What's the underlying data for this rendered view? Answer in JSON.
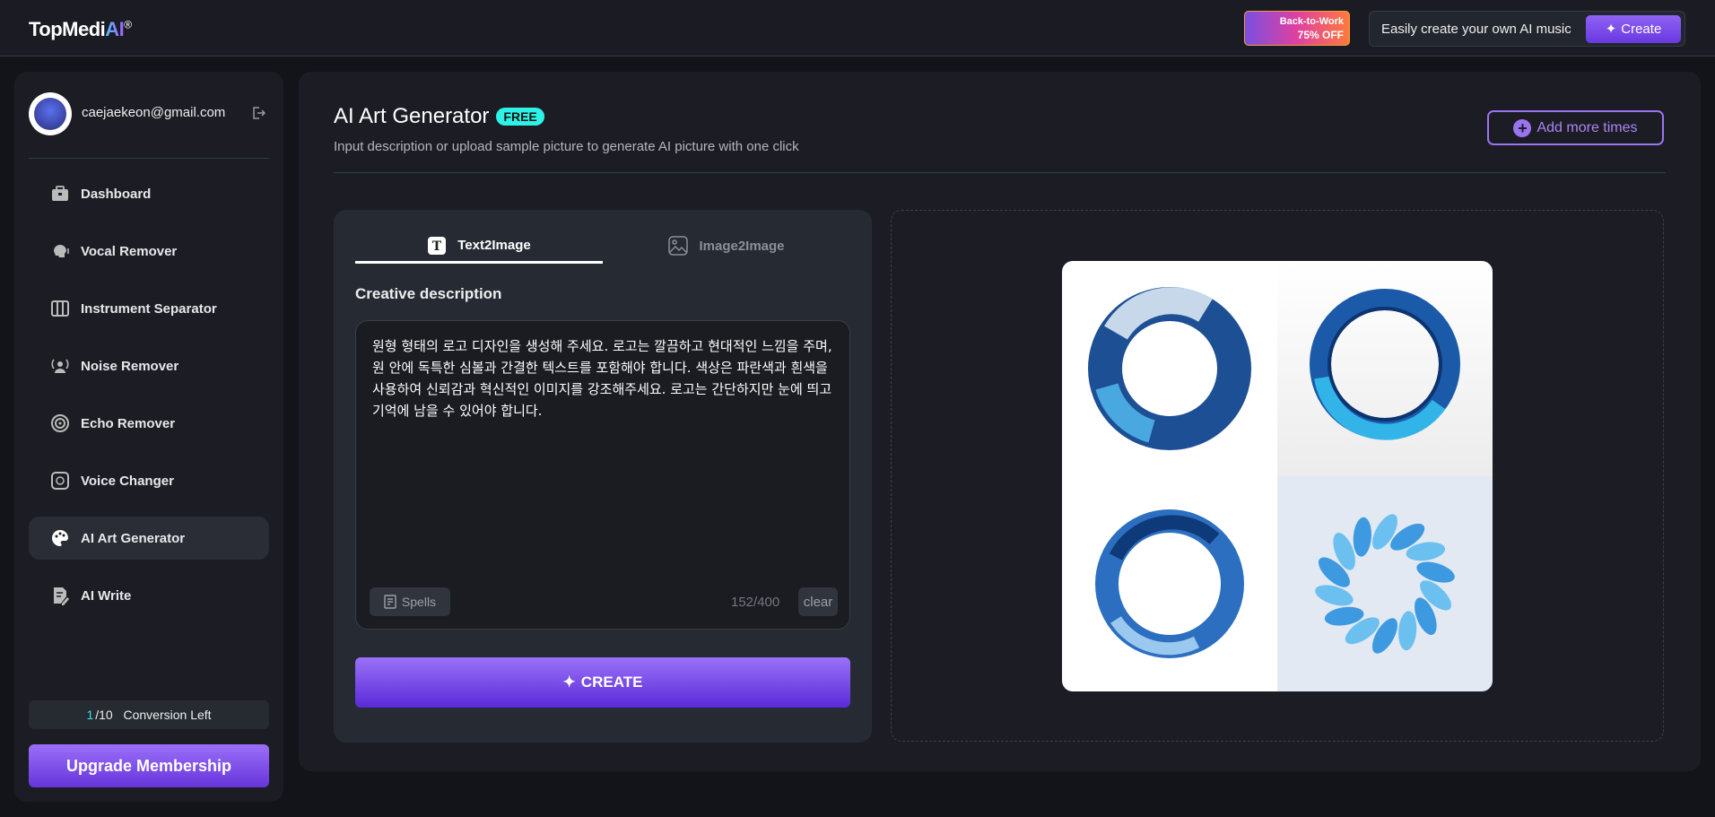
{
  "header": {
    "logo": {
      "text": "TopMedi",
      "ai": "AI",
      "reg": "®"
    },
    "promo": {
      "line1": "Back-to-Work",
      "line2": "75% OFF"
    },
    "cta_text": "Easily create your own AI music",
    "cta_button": "Create"
  },
  "sidebar": {
    "email": "caejaekeon@gmail.com",
    "items": [
      {
        "label": "Dashboard",
        "icon": "briefcase-icon"
      },
      {
        "label": "Vocal Remover",
        "icon": "head-voice-icon"
      },
      {
        "label": "Instrument Separator",
        "icon": "piano-icon"
      },
      {
        "label": "Noise Remover",
        "icon": "broadcast-user-icon"
      },
      {
        "label": "Echo Remover",
        "icon": "echo-icon"
      },
      {
        "label": "Voice Changer",
        "icon": "voice-changer-icon"
      },
      {
        "label": "AI Art Generator",
        "icon": "palette-icon",
        "active": true
      },
      {
        "label": "AI Write",
        "icon": "write-icon"
      }
    ],
    "conversion": {
      "used": "1",
      "total": "/10",
      "label": "Conversion Left"
    },
    "upgrade": "Upgrade Membership"
  },
  "main": {
    "title": "AI Art Generator",
    "badge": "FREE",
    "subtitle": "Input description or upload sample picture to generate AI picture with one click",
    "add_more": "Add more times",
    "tabs": [
      {
        "label": "Text2Image",
        "active": true
      },
      {
        "label": "Image2Image"
      }
    ],
    "description_label": "Creative description",
    "prompt": "원형 형태의 로고 디자인을 생성해 주세요. 로고는 깔끔하고 현대적인 느낌을 주며, 원 안에 독특한 심볼과 간결한 텍스트를 포함해야 합니다. 색상은 파란색과 흰색을 사용하여 신뢰감과 혁신적인 이미지를 강조해주세요. 로고는 간단하지만 눈에 띄고 기억에 남을 수 있어야 합니다.",
    "spells": "Spells",
    "count": "152/400",
    "clear": "clear",
    "create": "CREATE"
  },
  "colors": {
    "accent": "#7c4dff",
    "badge": "#2ef2e6"
  }
}
